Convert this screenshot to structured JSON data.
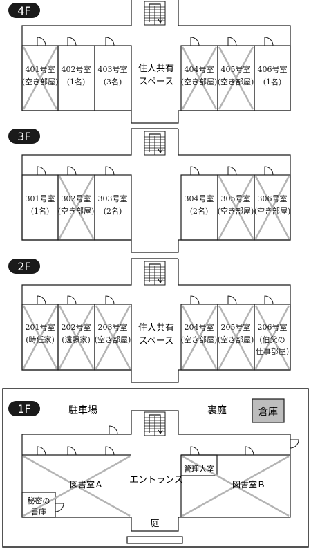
{
  "floors": [
    {
      "label": "4F",
      "left_rooms": [
        {
          "name": "401号室",
          "sub": "(空き部屋)",
          "vacant": true
        },
        {
          "name": "402号室",
          "sub": "(1名)",
          "vacant": false
        },
        {
          "name": "403号室",
          "sub": "(3名)",
          "vacant": false
        }
      ],
      "center": [
        "住人共有",
        "スペース"
      ],
      "right_rooms": [
        {
          "name": "404号室",
          "sub": "(空き部屋)",
          "vacant": true
        },
        {
          "name": "405号室",
          "sub": "(空き部屋)",
          "vacant": true
        },
        {
          "name": "406号室",
          "sub": "(1名)",
          "vacant": false
        }
      ]
    },
    {
      "label": "3F",
      "left_rooms": [
        {
          "name": "301号室",
          "sub": "(1名)",
          "vacant": false
        },
        {
          "name": "302号室",
          "sub": "(空き部屋)",
          "vacant": true
        },
        {
          "name": "303号室",
          "sub": "(2名)",
          "vacant": false
        }
      ],
      "center": [],
      "right_rooms": [
        {
          "name": "304号室",
          "sub": "(2名)",
          "vacant": false
        },
        {
          "name": "305号室",
          "sub": "(空き部屋)",
          "vacant": true
        },
        {
          "name": "306号室",
          "sub": "(空き部屋)",
          "vacant": true
        }
      ]
    },
    {
      "label": "2F",
      "left_rooms": [
        {
          "name": "201号室",
          "sub": "(時任家)",
          "vacant": true
        },
        {
          "name": "202号室",
          "sub": "(遠藤家)",
          "vacant": true
        },
        {
          "name": "203号室",
          "sub": "(空き部屋)",
          "vacant": true
        }
      ],
      "center": [
        "住人共有",
        "スペース"
      ],
      "right_rooms": [
        {
          "name": "204号室",
          "sub": "(空き部屋)",
          "vacant": true
        },
        {
          "name": "205号室",
          "sub": "(空き部屋)",
          "vacant": true
        },
        {
          "name": "206号室",
          "sub": "(伯父の",
          "sub2": "仕事部屋)",
          "vacant": true
        }
      ]
    }
  ],
  "ground": {
    "label": "1F",
    "parking": "駐車場",
    "backyard": "裏庭",
    "storage": "倉庫",
    "library_a": "図書室Ａ",
    "library_b": "図書室Ｂ",
    "entrance": "エントランス",
    "manager_room": "管理人室",
    "secret_line1": "秘密の",
    "secret_line2": "書庫",
    "garden": "庭"
  },
  "colors": {
    "line": "#1a1a1a",
    "cross": "#b4b4b4",
    "storage_fill": "#bdbdbd",
    "label_fill": "#1a1a1a",
    "label_text": "#ffffff"
  }
}
